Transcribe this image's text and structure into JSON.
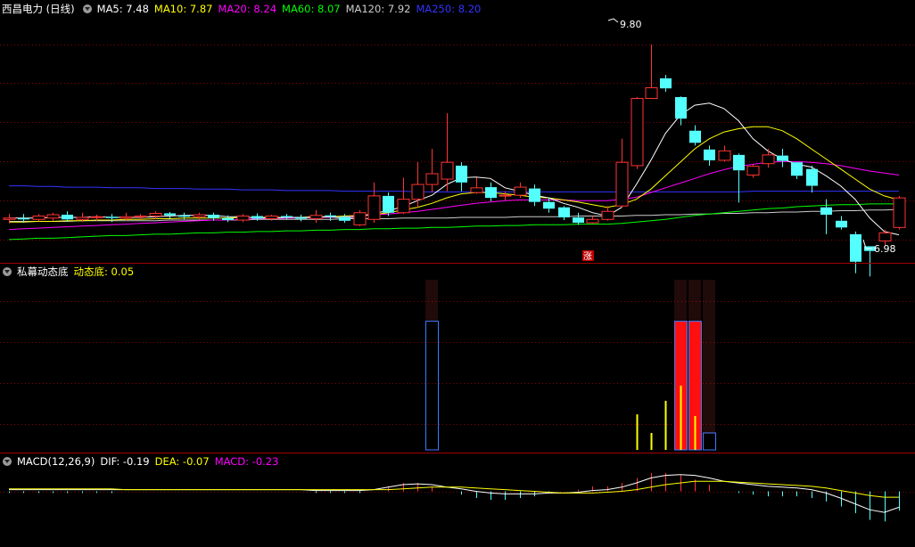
{
  "header": {
    "stock_title": "西昌电力 (日线)",
    "ma_labels": [
      {
        "text": "MA5: 7.48",
        "color": "#ffffff"
      },
      {
        "text": "MA10: 7.87",
        "color": "#ffff00"
      },
      {
        "text": "MA20: 8.24",
        "color": "#ff00ff"
      },
      {
        "text": "MA60: 8.07",
        "color": "#00ff00"
      },
      {
        "text": "MA120: 7.92",
        "color": "#cccccc"
      },
      {
        "text": "MA250: 8.20",
        "color": "#3333ff"
      }
    ]
  },
  "indicator": {
    "name": "私幕动态底",
    "label": "动态底: 0.05"
  },
  "macd": {
    "name": "MACD(12,26,9)",
    "dif": "DIF: -0.19",
    "dea": "DEA: -0.07",
    "macd": "MACD: -0.23"
  },
  "annotations": {
    "high": "9.80",
    "low": "6.98",
    "limit_up": "涨"
  },
  "colors": {
    "up": "#ff3333",
    "down": "#54ffff",
    "divider": "#a00000"
  },
  "chart_data": {
    "type": "candlestick",
    "price_ylim": [
      6.7,
      10.2
    ],
    "candles": [
      [
        7.2,
        7.22,
        7.14,
        7.28
      ],
      [
        7.22,
        7.2,
        7.15,
        7.28
      ],
      [
        7.2,
        7.25,
        7.17,
        7.28
      ],
      [
        7.22,
        7.27,
        7.18,
        7.3
      ],
      [
        7.27,
        7.2,
        7.17,
        7.32
      ],
      [
        7.2,
        7.23,
        7.16,
        7.3
      ],
      [
        7.23,
        7.24,
        7.18,
        7.27
      ],
      [
        7.24,
        7.22,
        7.16,
        7.28
      ],
      [
        7.22,
        7.24,
        7.18,
        7.3
      ],
      [
        7.24,
        7.25,
        7.2,
        7.28
      ],
      [
        7.25,
        7.29,
        7.2,
        7.32
      ],
      [
        7.29,
        7.26,
        7.21,
        7.31
      ],
      [
        7.26,
        7.24,
        7.2,
        7.3
      ],
      [
        7.24,
        7.27,
        7.2,
        7.3
      ],
      [
        7.27,
        7.22,
        7.18,
        7.3
      ],
      [
        7.22,
        7.19,
        7.16,
        7.26
      ],
      [
        7.19,
        7.25,
        7.16,
        7.28
      ],
      [
        7.25,
        7.21,
        7.18,
        7.29
      ],
      [
        7.21,
        7.25,
        7.18,
        7.27
      ],
      [
        7.25,
        7.23,
        7.2,
        7.28
      ],
      [
        7.23,
        7.21,
        7.17,
        7.27
      ],
      [
        7.21,
        7.26,
        7.15,
        7.34
      ],
      [
        7.26,
        7.24,
        7.18,
        7.3
      ],
      [
        7.24,
        7.18,
        7.15,
        7.28
      ],
      [
        7.12,
        7.3,
        7.1,
        7.34
      ],
      [
        7.2,
        7.55,
        7.15,
        7.75
      ],
      [
        7.55,
        7.3,
        7.25,
        7.6
      ],
      [
        7.3,
        7.5,
        7.28,
        7.82
      ],
      [
        7.5,
        7.72,
        7.38,
        8.05
      ],
      [
        7.72,
        7.88,
        7.6,
        8.25
      ],
      [
        7.8,
        8.05,
        7.62,
        8.78
      ],
      [
        8.0,
        7.75,
        7.62,
        8.05
      ],
      [
        7.6,
        7.67,
        7.58,
        7.82
      ],
      [
        7.68,
        7.52,
        7.47,
        7.75
      ],
      [
        7.55,
        7.56,
        7.48,
        7.62
      ],
      [
        7.56,
        7.68,
        7.52,
        7.75
      ],
      [
        7.66,
        7.46,
        7.4,
        7.72
      ],
      [
        7.46,
        7.36,
        7.3,
        7.52
      ],
      [
        7.38,
        7.23,
        7.19,
        7.4
      ],
      [
        7.23,
        7.15,
        7.12,
        7.3
      ],
      [
        7.15,
        7.2,
        7.14,
        7.25
      ],
      [
        7.2,
        7.32,
        7.18,
        7.4
      ],
      [
        7.4,
        8.05,
        7.38,
        8.4
      ],
      [
        8.0,
        9.0,
        7.95,
        9.02
      ],
      [
        9.0,
        9.16,
        9.05,
        9.8
      ],
      [
        9.3,
        9.15,
        9.1,
        9.35
      ],
      [
        9.02,
        8.7,
        8.6,
        9.03
      ],
      [
        8.52,
        8.34,
        8.3,
        8.6
      ],
      [
        8.24,
        8.08,
        8.0,
        8.3
      ],
      [
        8.08,
        8.22,
        8.06,
        8.3
      ],
      [
        8.16,
        7.93,
        7.45,
        8.18
      ],
      [
        7.86,
        7.99,
        7.82,
        8.02
      ],
      [
        8.03,
        8.16,
        7.97,
        8.25
      ],
      [
        8.15,
        8.07,
        7.98,
        8.25
      ],
      [
        8.05,
        7.85,
        7.8,
        8.05
      ],
      [
        7.95,
        7.7,
        7.6,
        8.0
      ],
      [
        7.38,
        7.27,
        6.98,
        7.5
      ],
      [
        7.18,
        7.08,
        7.05,
        7.25
      ],
      [
        6.98,
        6.57,
        6.4,
        7.02
      ],
      [
        6.8,
        6.73,
        6.35,
        6.8
      ],
      [
        6.88,
        7.0,
        6.82,
        7.05
      ],
      [
        7.08,
        7.52,
        7.05,
        7.55
      ]
    ],
    "ma": {
      "MA5": [
        7.22,
        7.22,
        7.22,
        7.23,
        7.23,
        7.23,
        7.24,
        7.23,
        7.23,
        7.23,
        7.24,
        7.25,
        7.26,
        7.26,
        7.26,
        7.24,
        7.24,
        7.22,
        7.22,
        7.23,
        7.23,
        7.23,
        7.24,
        7.22,
        7.24,
        7.29,
        7.33,
        7.39,
        7.48,
        7.56,
        7.72,
        7.82,
        7.83,
        7.81,
        7.67,
        7.62,
        7.56,
        7.52,
        7.44,
        7.38,
        7.3,
        7.25,
        7.38,
        7.72,
        8.08,
        8.48,
        8.75,
        8.9,
        8.93,
        8.85,
        8.67,
        8.4,
        8.22,
        8.1,
        8.02,
        7.98,
        7.85,
        7.7,
        7.5,
        7.22,
        7.02,
        6.97
      ],
      "MA10": [
        7.16,
        7.16,
        7.17,
        7.17,
        7.18,
        7.18,
        7.19,
        7.19,
        7.2,
        7.2,
        7.21,
        7.21,
        7.22,
        7.22,
        7.22,
        7.22,
        7.23,
        7.23,
        7.23,
        7.23,
        7.23,
        7.24,
        7.24,
        7.25,
        7.26,
        7.27,
        7.3,
        7.34,
        7.38,
        7.44,
        7.52,
        7.58,
        7.6,
        7.6,
        7.58,
        7.56,
        7.53,
        7.52,
        7.49,
        7.46,
        7.42,
        7.38,
        7.42,
        7.5,
        7.65,
        7.85,
        8.05,
        8.25,
        8.4,
        8.5,
        8.55,
        8.58,
        8.58,
        8.52,
        8.4,
        8.25,
        8.1,
        7.95,
        7.8,
        7.65,
        7.55,
        7.49
      ],
      "MA20": [
        7.05,
        7.06,
        7.07,
        7.08,
        7.09,
        7.1,
        7.11,
        7.12,
        7.13,
        7.14,
        7.15,
        7.16,
        7.17,
        7.18,
        7.19,
        7.19,
        7.2,
        7.21,
        7.21,
        7.22,
        7.22,
        7.23,
        7.23,
        7.24,
        7.25,
        7.27,
        7.28,
        7.3,
        7.32,
        7.35,
        7.38,
        7.41,
        7.44,
        7.46,
        7.48,
        7.49,
        7.49,
        7.49,
        7.49,
        7.48,
        7.48,
        7.48,
        7.5,
        7.53,
        7.6,
        7.67,
        7.74,
        7.81,
        7.88,
        7.94,
        7.99,
        8.02,
        8.05,
        8.06,
        8.06,
        8.05,
        8.03,
        8.0,
        7.96,
        7.92,
        7.89,
        7.86
      ],
      "MA60": [
        6.9,
        6.91,
        6.92,
        6.92,
        6.93,
        6.94,
        6.95,
        6.96,
        6.96,
        6.97,
        6.98,
        6.98,
        6.99,
        7.0,
        7.0,
        7.01,
        7.01,
        7.02,
        7.02,
        7.03,
        7.03,
        7.04,
        7.04,
        7.05,
        7.05,
        7.06,
        7.06,
        7.07,
        7.07,
        7.08,
        7.08,
        7.09,
        7.1,
        7.1,
        7.11,
        7.11,
        7.12,
        7.12,
        7.12,
        7.13,
        7.13,
        7.13,
        7.14,
        7.16,
        7.18,
        7.2,
        7.23,
        7.26,
        7.28,
        7.3,
        7.32,
        7.34,
        7.36,
        7.37,
        7.39,
        7.4,
        7.41,
        7.42,
        7.42,
        7.43,
        7.43,
        7.43
      ],
      "MA120": [
        7.17,
        7.17,
        7.17,
        7.17,
        7.17,
        7.18,
        7.18,
        7.18,
        7.18,
        7.18,
        7.18,
        7.19,
        7.19,
        7.19,
        7.19,
        7.19,
        7.19,
        7.2,
        7.2,
        7.2,
        7.2,
        7.2,
        7.2,
        7.21,
        7.21,
        7.21,
        7.21,
        7.22,
        7.22,
        7.22,
        7.22,
        7.23,
        7.23,
        7.23,
        7.23,
        7.24,
        7.24,
        7.24,
        7.24,
        7.25,
        7.25,
        7.25,
        7.25,
        7.26,
        7.26,
        7.27,
        7.27,
        7.28,
        7.28,
        7.29,
        7.29,
        7.3,
        7.3,
        7.31,
        7.31,
        7.32,
        7.32,
        7.33,
        7.33,
        7.34,
        7.34,
        7.35
      ],
      "MA250": [
        7.7,
        7.7,
        7.69,
        7.69,
        7.68,
        7.68,
        7.68,
        7.67,
        7.67,
        7.67,
        7.66,
        7.66,
        7.66,
        7.65,
        7.65,
        7.65,
        7.64,
        7.64,
        7.64,
        7.63,
        7.63,
        7.63,
        7.63,
        7.62,
        7.62,
        7.62,
        7.62,
        7.62,
        7.61,
        7.61,
        7.61,
        7.61,
        7.61,
        7.61,
        7.61,
        7.61,
        7.61,
        7.61,
        7.61,
        7.61,
        7.61,
        7.61,
        7.61,
        7.61,
        7.61,
        7.61,
        7.61,
        7.61,
        7.61,
        7.61,
        7.61,
        7.62,
        7.62,
        7.62,
        7.62,
        7.62,
        7.62,
        7.62,
        7.62,
        7.62,
        7.62,
        7.62
      ]
    },
    "indicator_ylim": [
      0,
      1
    ],
    "indicator_bars": [
      {
        "i": 29,
        "type": "blue",
        "value": 0.76
      },
      {
        "i": 43,
        "type": "yellow",
        "value": 0.21
      },
      {
        "i": 44,
        "type": "yellow",
        "value": 0.1
      },
      {
        "i": 45,
        "type": "yellow",
        "value": 0.29
      },
      {
        "i": 46,
        "type": "red",
        "value": 0.76
      },
      {
        "i": 46,
        "type": "yellow",
        "value": 0.38
      },
      {
        "i": 47,
        "type": "red",
        "value": 0.76
      },
      {
        "i": 47,
        "type": "yellow",
        "value": 0.2
      },
      {
        "i": 48,
        "type": "blue",
        "value": 0.1
      }
    ],
    "macd_ylim": [
      -0.6,
      0.25
    ],
    "dif": [
      0.02,
      0.02,
      0.02,
      0.02,
      0.02,
      0.02,
      0.02,
      0.02,
      0.02,
      0.02,
      0.02,
      0.02,
      0.02,
      0.02,
      0.02,
      0.02,
      0.02,
      0.02,
      0.02,
      0.02,
      0.02,
      0.01,
      0.01,
      0.01,
      0.01,
      0.02,
      0.05,
      0.08,
      0.09,
      0.08,
      0.05,
      0.03,
      0.0,
      -0.02,
      -0.03,
      -0.03,
      -0.03,
      -0.02,
      -0.02,
      -0.01,
      0.01,
      0.02,
      0.05,
      0.1,
      0.16,
      0.19,
      0.2,
      0.19,
      0.16,
      0.12,
      0.1,
      0.08,
      0.06,
      0.05,
      0.04,
      0.02,
      -0.02,
      -0.08,
      -0.15,
      -0.22,
      -0.25,
      -0.19
    ],
    "dea": [
      0.03,
      0.03,
      0.03,
      0.03,
      0.03,
      0.03,
      0.03,
      0.03,
      0.02,
      0.02,
      0.02,
      0.02,
      0.02,
      0.02,
      0.02,
      0.02,
      0.02,
      0.02,
      0.02,
      0.02,
      0.02,
      0.02,
      0.02,
      0.02,
      0.02,
      0.02,
      0.02,
      0.03,
      0.04,
      0.05,
      0.05,
      0.05,
      0.04,
      0.03,
      0.02,
      0.01,
      0.0,
      -0.01,
      -0.02,
      -0.02,
      -0.02,
      -0.01,
      0.0,
      0.02,
      0.05,
      0.08,
      0.1,
      0.12,
      0.12,
      0.12,
      0.11,
      0.1,
      0.09,
      0.08,
      0.07,
      0.06,
      0.04,
      0.01,
      -0.02,
      -0.05,
      -0.07,
      -0.07
    ],
    "macd_hist": [
      -0.02,
      -0.02,
      -0.02,
      -0.02,
      -0.02,
      -0.02,
      -0.02,
      -0.02,
      0.0,
      0.0,
      0.0,
      0.0,
      0.0,
      0.0,
      0.0,
      0.0,
      0.0,
      0.0,
      0.0,
      0.0,
      0.0,
      -0.02,
      -0.02,
      -0.02,
      -0.02,
      0.0,
      0.06,
      0.1,
      0.1,
      0.06,
      0.0,
      -0.04,
      -0.08,
      -0.1,
      -0.1,
      -0.08,
      -0.06,
      -0.02,
      0.0,
      0.02,
      0.06,
      0.06,
      0.1,
      0.16,
      0.22,
      0.22,
      0.2,
      0.14,
      0.08,
      0.0,
      -0.02,
      -0.04,
      -0.06,
      -0.06,
      -0.06,
      -0.08,
      -0.12,
      -0.18,
      -0.26,
      -0.34,
      -0.36,
      -0.23
    ]
  }
}
